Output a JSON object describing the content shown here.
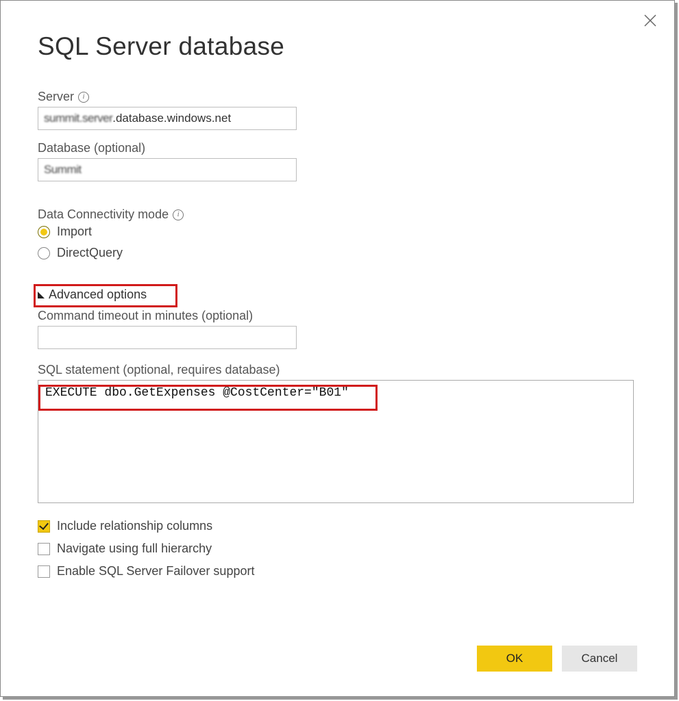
{
  "dialog": {
    "title": "SQL Server database",
    "server_label": "Server",
    "server_value_obscured_prefix": "summit.server",
    "server_value_suffix": ".database.windows.net",
    "database_label": "Database (optional)",
    "database_value_obscured": "Summit",
    "connectivity_label": "Data Connectivity mode",
    "connectivity_options": [
      {
        "label": "Import",
        "checked": true
      },
      {
        "label": "DirectQuery",
        "checked": false
      }
    ],
    "advanced_toggle": "Advanced options",
    "advanced_expanded": true,
    "timeout_label": "Command timeout in minutes (optional)",
    "timeout_value": "",
    "sql_label": "SQL statement (optional, requires database)",
    "sql_value": "EXECUTE dbo.GetExpenses @CostCenter=\"B01\"",
    "checks": [
      {
        "label": "Include relationship columns",
        "checked": true
      },
      {
        "label": "Navigate using full hierarchy",
        "checked": false
      },
      {
        "label": "Enable SQL Server Failover support",
        "checked": false
      }
    ],
    "ok": "OK",
    "cancel": "Cancel"
  },
  "highlights": {
    "advanced": true,
    "sql_first_line": true
  }
}
